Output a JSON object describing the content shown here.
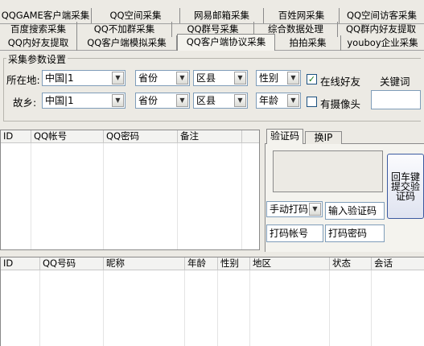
{
  "tabs": {
    "row1": [
      "QQGAME客户端采集",
      "QQ空间采集",
      "网易邮箱采集",
      "百姓网采集",
      "QQ空间访客采集"
    ],
    "row2": [
      "百度搜索采集",
      "QQ不加群采集",
      "QQ群号采集",
      "综合数据处理",
      "QQ群内好友提取"
    ],
    "row3": [
      "QQ内好友提取",
      "QQ客户端模拟采集",
      "QQ客户端协议采集",
      "拍拍采集",
      "youboy企业采集"
    ]
  },
  "params": {
    "group_title": "采集参数设置",
    "location_label": "所在地:",
    "hometown_label": "故乡:",
    "country1": "中国|1",
    "province1": "省份",
    "county1": "区县",
    "gender": "性别",
    "online_label": "在线好友",
    "online_checked": true,
    "keyword_label": "关键词",
    "country2": "中国|1",
    "province2": "省份",
    "county2": "区县",
    "age": "年龄",
    "camera_label": "有摄像头",
    "camera_checked": false
  },
  "account_grid": {
    "columns": [
      "ID",
      "QQ帐号",
      "QQ密码",
      "备注"
    ]
  },
  "captcha": {
    "tab_captcha": "验证码",
    "tab_ip": "换IP",
    "mode": "手动打码",
    "input_label": "输入验证码",
    "account_label": "打码帐号",
    "password_label": "打码密码",
    "submit_label": "回车键提交验证码"
  },
  "result_grid": {
    "columns": [
      "ID",
      "QQ号码",
      "昵称",
      "年龄",
      "性别",
      "地区",
      "状态",
      "会话"
    ]
  }
}
